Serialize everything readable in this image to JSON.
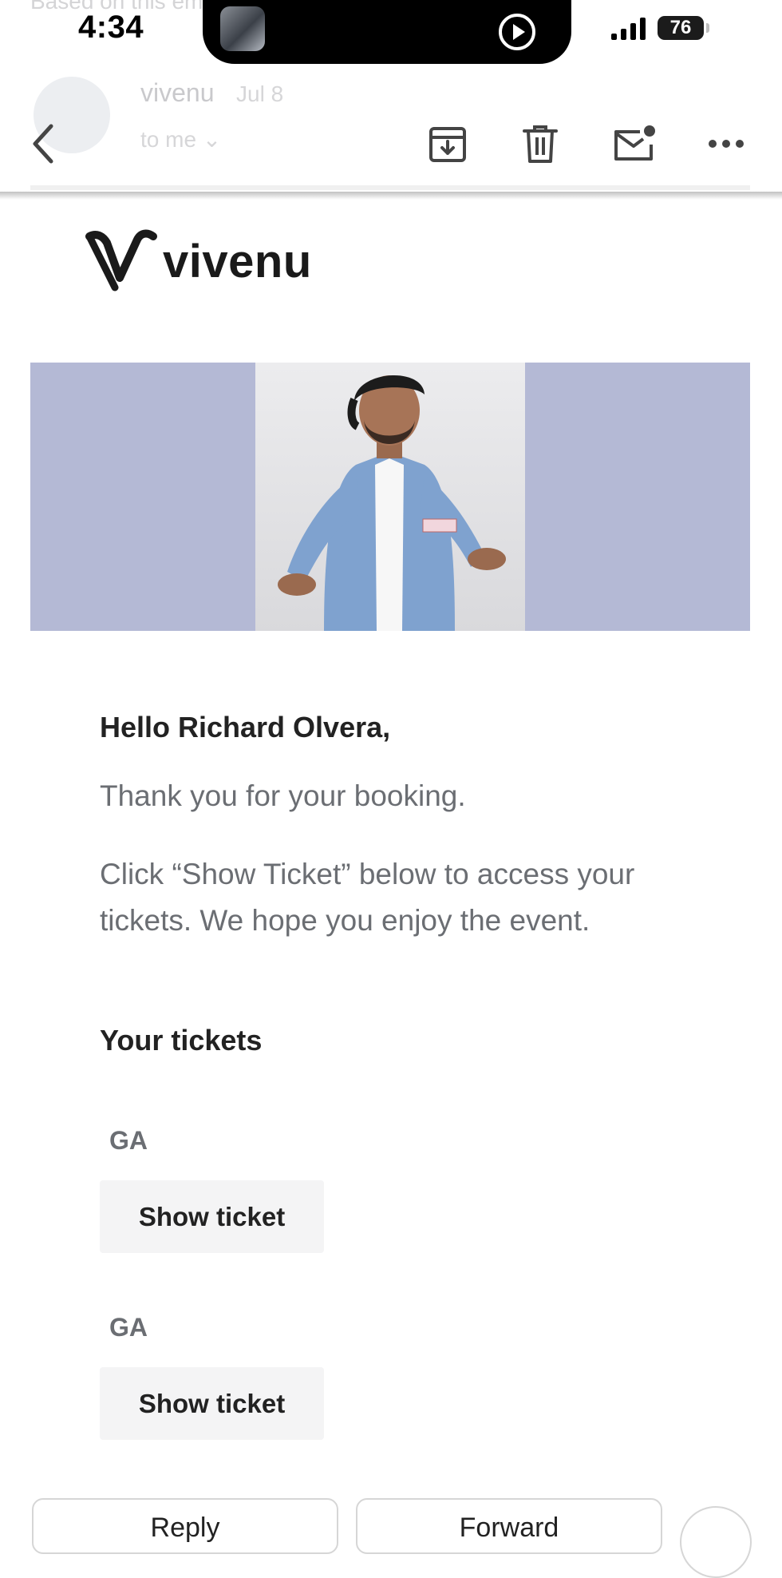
{
  "status_bar": {
    "time": "4:34",
    "battery": "76"
  },
  "background_header": {
    "hint": "Based on this email... ...t?",
    "sender": "vivenu",
    "date": "Jul 8",
    "recipient": "to me ⌄"
  },
  "toolbar": {
    "icons": [
      "back-icon",
      "archive-icon",
      "trash-icon",
      "mark-unread-icon",
      "more-icon"
    ]
  },
  "email": {
    "logo_text": "vivenu",
    "greeting": "Hello Richard Olvera,",
    "thanks": "Thank you for your booking.",
    "instructions": "Click “Show Ticket” below to access your tickets. We hope you enjoy the event.",
    "tickets_heading": "Your tickets",
    "tickets": [
      {
        "type": "GA",
        "button_label": "Show ticket"
      },
      {
        "type": "GA",
        "button_label": "Show ticket"
      }
    ]
  },
  "reply_bar": {
    "reply_label": "Reply",
    "forward_label": "Forward"
  },
  "colors": {
    "banner": "#b4b9d5",
    "body_text": "#6b6e73",
    "button_bg": "#f4f4f5"
  }
}
